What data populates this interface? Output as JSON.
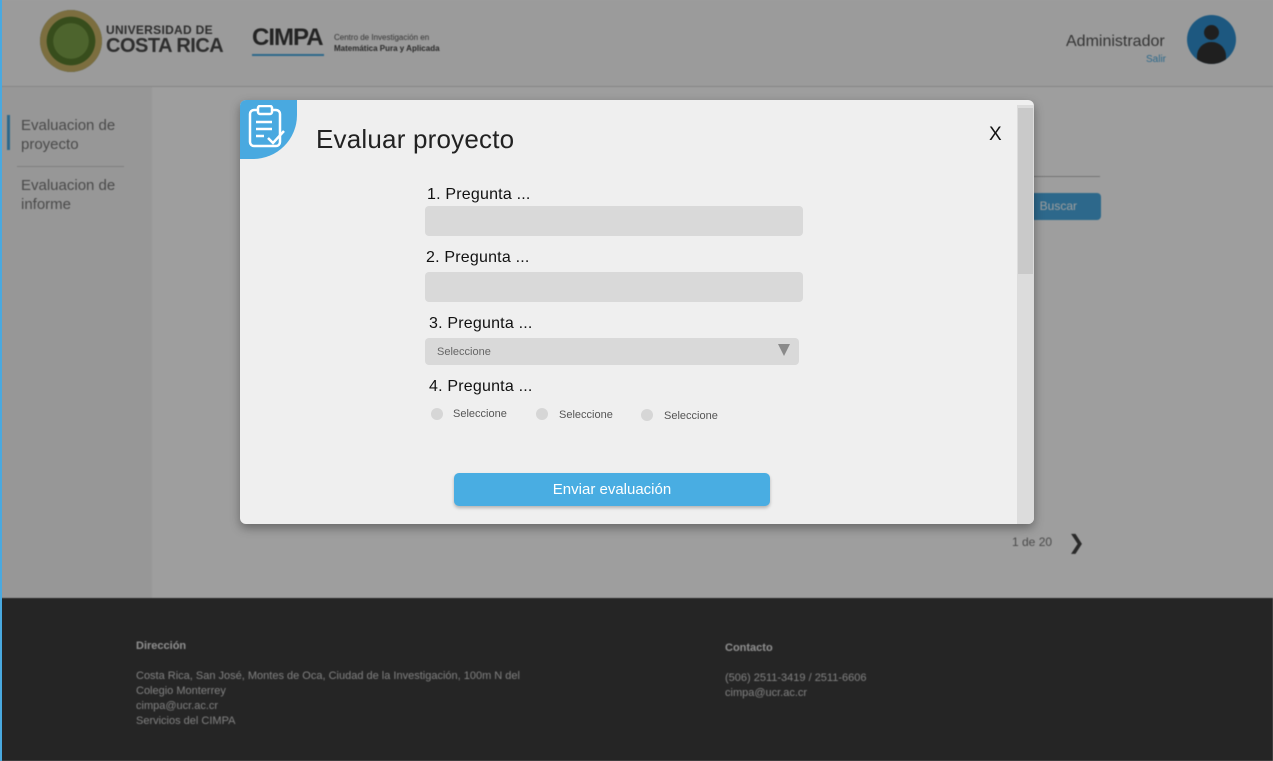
{
  "header": {
    "university_line1": "UNIVERSIDAD DE",
    "university_line2": "COSTA RICA",
    "cimpa_title": "CIMPA",
    "cimpa_sub1": "Centro de Investigación en",
    "cimpa_sub2": "Matemática Pura y Aplicada",
    "user_name": "Administrador",
    "logout_label": "Salir"
  },
  "sidebar": {
    "items": [
      {
        "label": "Evaluacion de proyecto",
        "active": true
      },
      {
        "label": "Evaluacion de informe",
        "active": false
      }
    ]
  },
  "main": {
    "search_label": "Buscar",
    "pagination": "1 de 20",
    "next_icon": "chevron-right-icon"
  },
  "footer": {
    "address_title": "Dirección",
    "address_lines": [
      "Costa Rica, San José, Montes de Oca, Ciudad de la Investigación, 100m N del",
      "Colegio Monterrey",
      "cimpa@ucr.ac.cr",
      "Servicios del CIMPA"
    ],
    "contact_title": "Contacto",
    "contact_lines": [
      "(506) 2511-3419 / 2511-6606",
      "cimpa@ucr.ac.cr"
    ]
  },
  "modal": {
    "title": "Evaluar proyecto",
    "close_label": "X",
    "icon": "clipboard-check-icon",
    "questions": [
      {
        "label": "1. Pregunta ...",
        "type": "text",
        "value": ""
      },
      {
        "label": "2. Pregunta ...",
        "type": "text",
        "value": ""
      },
      {
        "label": "3. Pregunta ...",
        "type": "select",
        "value": "Seleccione"
      },
      {
        "label": "4. Pregunta ...",
        "type": "radio",
        "options": [
          "Seleccione",
          "Seleccione",
          "Seleccione"
        ]
      }
    ],
    "submit_label": "Enviar evaluación"
  },
  "colors": {
    "accent": "#49a9e0",
    "modal_bg": "#efefef",
    "footer_bg": "#3d3d3d",
    "field_bg": "#d9d9d9"
  }
}
